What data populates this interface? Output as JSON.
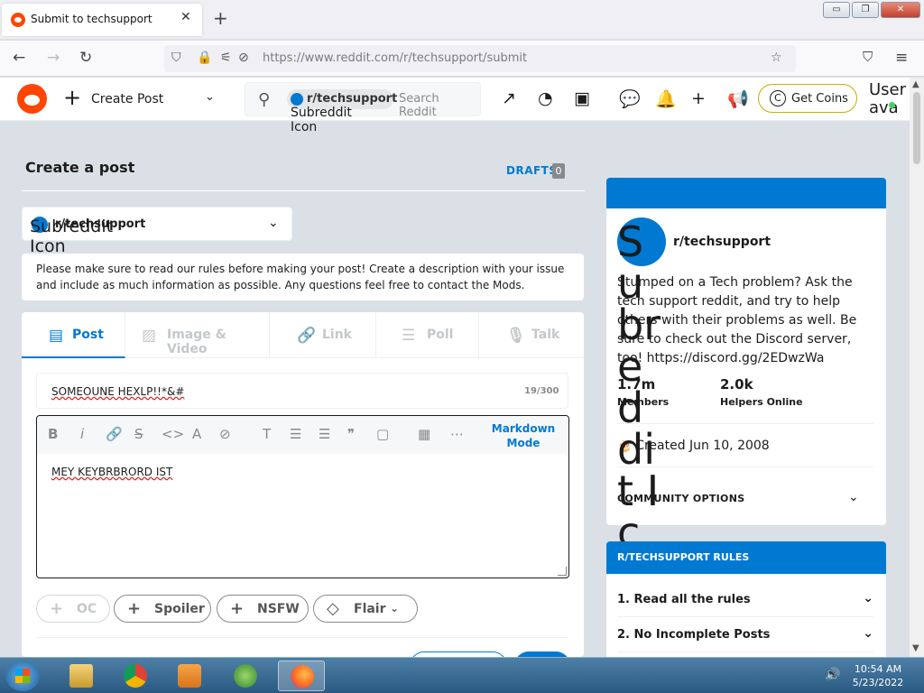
{
  "browser": {
    "tab_title": "Submit to techsupport",
    "tab_close": "✕",
    "new_tab": "+",
    "url_host": "https://www.reddit.com",
    "url_path": "/r/techsupport/submit",
    "window_controls": [
      "▭",
      "❐",
      "✕"
    ]
  },
  "header": {
    "create_label": "Create Post",
    "search_chip": "r/techsupport",
    "search_placeholder": "Search Reddit",
    "subreddit_icon_alt": "Subreddit Icon",
    "coins_label": "Get Coins",
    "user_alt": "User ava"
  },
  "page": {
    "title": "Create a post",
    "drafts_label": "DRAFTS",
    "drafts_count": "0",
    "subreddit_selected": "r/techsupport",
    "subreddit_icon_alt": "Subreddit Icon",
    "rules_notice": "Please make sure to read our rules before making your post! Create a description with your issue and include as much information as possible. Any questions feel free to contact the Mods."
  },
  "editor": {
    "tabs": [
      {
        "label": "Post",
        "icon": "▤"
      },
      {
        "label": "Image & Video",
        "icon": "▨"
      },
      {
        "label": "Link",
        "icon": "🔗"
      },
      {
        "label": "Poll",
        "icon": "☰"
      },
      {
        "label": "Talk",
        "icon": "🎙"
      }
    ],
    "title_value": "SOMEOUNE HEXLP!!*&#",
    "title_count": "19/300",
    "markdown_mode": "Markdown Mode",
    "body_value": "MEY KEYBRBRORD IST",
    "flags": [
      {
        "label": "OC",
        "icon": "+"
      },
      {
        "label": "Spoiler",
        "icon": "+"
      },
      {
        "label": "NSFW",
        "icon": "+"
      },
      {
        "label": "Flair",
        "icon": "◇"
      }
    ]
  },
  "sidebar": {
    "community_name": "r/techsupport",
    "icon_alt": "Subreddit Icon",
    "description": "Stumped on a Tech problem? Ask the tech support reddit, and try to help others with their problems as well. Be sure to check out the Discord server, too! https://discord.gg/2EDwzWa",
    "members_value": "1.7m",
    "members_label": "Members",
    "online_value": "2.0k",
    "online_label": "Helpers Online",
    "created": "Created Jun 10, 2008",
    "community_options": "COMMUNITY OPTIONS",
    "rules_title": "R/TECHSUPPORT RULES",
    "rules": [
      "1. Read all the rules",
      "2. No Incomplete Posts"
    ]
  },
  "taskbar": {
    "time": "10:54 AM",
    "date": "5/23/2022"
  },
  "colors": {
    "accent": "#0079d3",
    "reddit_orange": "#ff4500",
    "page_bg": "#dae0e6"
  }
}
